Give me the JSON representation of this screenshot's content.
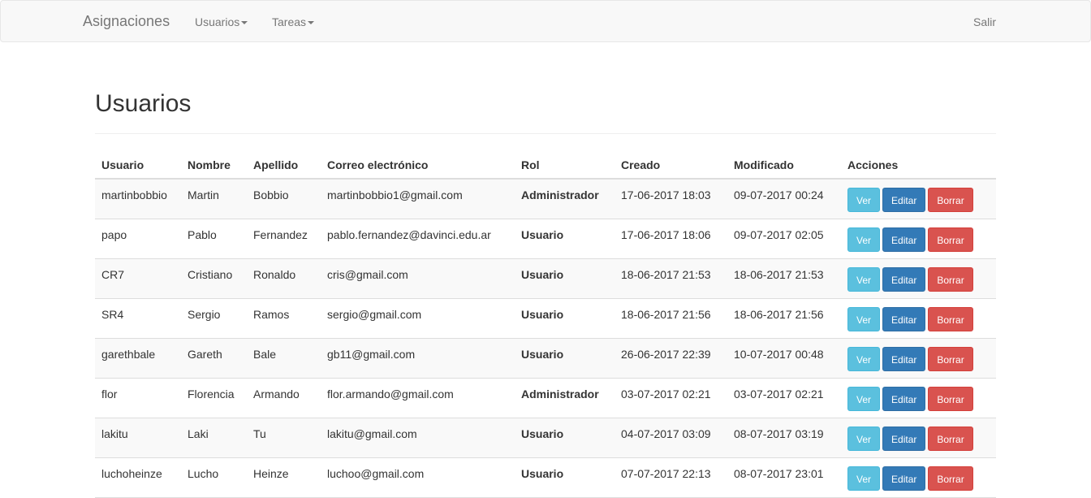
{
  "navbar": {
    "brand": "Asignaciones",
    "menu": [
      {
        "label": "Usuarios"
      },
      {
        "label": "Tareas"
      }
    ],
    "logout": "Salir"
  },
  "page": {
    "title": "Usuarios"
  },
  "table": {
    "headers": [
      "Usuario",
      "Nombre",
      "Apellido",
      "Correo electrónico",
      "Rol",
      "Creado",
      "Modificado",
      "Acciones"
    ],
    "actions": {
      "view": "Ver",
      "edit": "Editar",
      "delete": "Borrar"
    },
    "rows": [
      {
        "usuario": "martinbobbio",
        "nombre": "Martin",
        "apellido": "Bobbio",
        "correo": "martinbobbio1@gmail.com",
        "rol": "Administrador",
        "creado": "17-06-2017 18:03",
        "modificado": "09-07-2017 00:24"
      },
      {
        "usuario": "papo",
        "nombre": "Pablo",
        "apellido": "Fernandez",
        "correo": "pablo.fernandez@davinci.edu.ar",
        "rol": "Usuario",
        "creado": "17-06-2017 18:06",
        "modificado": "09-07-2017 02:05"
      },
      {
        "usuario": "CR7",
        "nombre": "Cristiano",
        "apellido": "Ronaldo",
        "correo": "cris@gmail.com",
        "rol": "Usuario",
        "creado": "18-06-2017 21:53",
        "modificado": "18-06-2017 21:53"
      },
      {
        "usuario": "SR4",
        "nombre": "Sergio",
        "apellido": "Ramos",
        "correo": "sergio@gmail.com",
        "rol": "Usuario",
        "creado": "18-06-2017 21:56",
        "modificado": "18-06-2017 21:56"
      },
      {
        "usuario": "garethbale",
        "nombre": "Gareth",
        "apellido": "Bale",
        "correo": "gb11@gmail.com",
        "rol": "Usuario",
        "creado": "26-06-2017 22:39",
        "modificado": "10-07-2017 00:48"
      },
      {
        "usuario": "flor",
        "nombre": "Florencia",
        "apellido": "Armando",
        "correo": "flor.armando@gmail.com",
        "rol": "Administrador",
        "creado": "03-07-2017 02:21",
        "modificado": "03-07-2017 02:21"
      },
      {
        "usuario": "lakitu",
        "nombre": "Laki",
        "apellido": "Tu",
        "correo": "lakitu@gmail.com",
        "rol": "Usuario",
        "creado": "04-07-2017 03:09",
        "modificado": "08-07-2017 03:19"
      },
      {
        "usuario": "luchoheinze",
        "nombre": "Lucho",
        "apellido": "Heinze",
        "correo": "luchoo@gmail.com",
        "rol": "Usuario",
        "creado": "07-07-2017 22:13",
        "modificado": "08-07-2017 23:01"
      }
    ]
  },
  "colors": {
    "navbar_bg": "#f8f8f8",
    "info": "#5bc0de",
    "primary": "#337ab7",
    "danger": "#d9534f",
    "striped_row": "#f9f9f9"
  }
}
